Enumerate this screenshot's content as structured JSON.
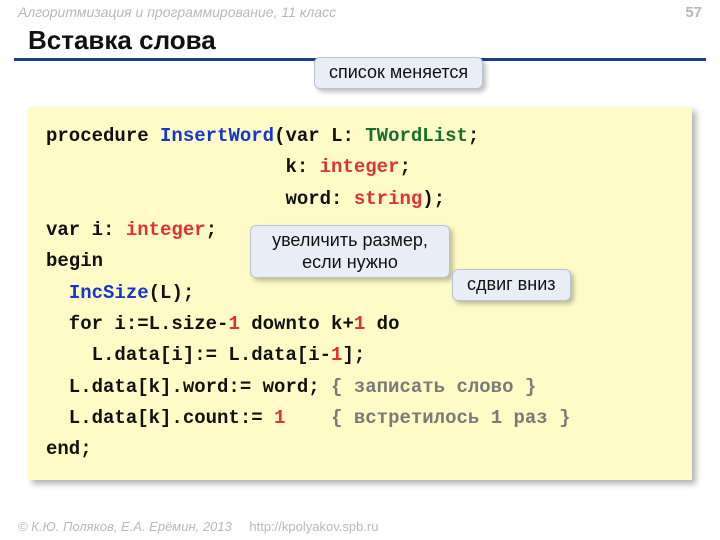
{
  "header": {
    "course": "Алгоритмизация и программирование, 11 класс",
    "page": "57"
  },
  "title": "Вставка слова",
  "callouts": {
    "c1": "список меняется",
    "c2": "увеличить размер,\nесли нужно",
    "c3": "сдвиг вниз"
  },
  "code": {
    "l1a": "procedure ",
    "l1b": "InsertWord",
    "l1c": "(var L: ",
    "l1d": "TWordList",
    "l1e": ";",
    "l2a": "                     k: ",
    "l2b": "integer",
    "l2c": ";",
    "l3a": "                     word: ",
    "l3b": "string",
    "l3c": ");",
    "l4a": "var i: ",
    "l4b": "integer",
    "l4c": ";",
    "l5": "begin",
    "l6a": "  ",
    "l6b": "IncSize",
    "l6c": "(L);",
    "l7a": "  for i:=L.size-",
    "l7b": "1",
    "l7c": " downto k+",
    "l7d": "1",
    "l7e": " do",
    "l8a": "    L.data[i]:= L.data[i-",
    "l8b": "1",
    "l8c": "];",
    "l9a": "  L.data[k].word:= word; ",
    "l9b": "{ записать слово }",
    "l10a": "  L.data[k].count:= ",
    "l10b": "1",
    "l10c": "    ",
    "l10d": "{ встретилось 1 раз }",
    "l11": "end;"
  },
  "footer": {
    "copyright": "© К.Ю. Поляков, Е.А. Ерёмин, 2013",
    "url": "http://kpolyakov.spb.ru"
  }
}
